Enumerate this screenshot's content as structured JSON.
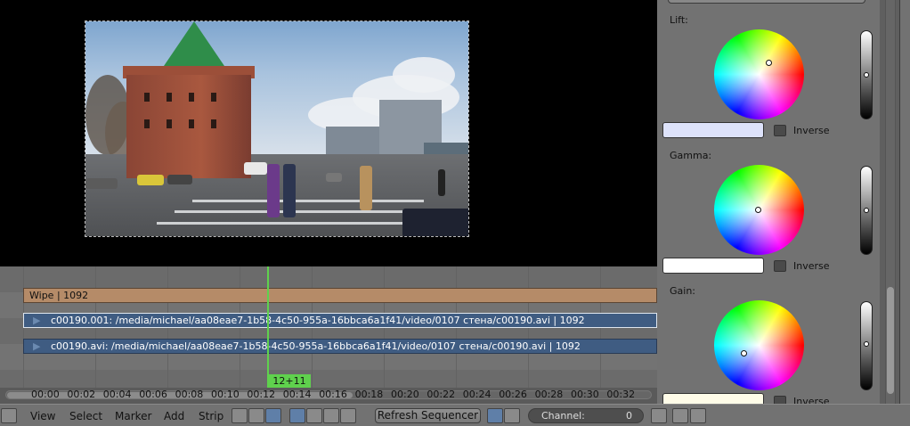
{
  "sequencer": {
    "strips": {
      "wipe": "Wipe | 1092",
      "image1": "c00190.001: /media/michael/aa08eae7-1b58-4c50-955a-16bbca6a1f41/video/0107 стена/c00190.avi | 1092",
      "image2": "c00190.avi: /media/michael/aa08eae7-1b58-4c50-955a-16bbca6a1f41/video/0107 стена/c00190.avi | 1092"
    },
    "current_frame": "12+11",
    "ticks": [
      "00:00",
      "00:02",
      "00:04",
      "00:06",
      "00:08",
      "00:10",
      "00:12",
      "00:14",
      "00:16",
      "00:18",
      "00:20",
      "00:22",
      "00:24",
      "00:26",
      "00:28",
      "00:30",
      "00:32"
    ]
  },
  "header": {
    "menus": [
      "View",
      "Select",
      "Marker",
      "Add",
      "Strip"
    ],
    "refresh_label": "Refresh Sequencer",
    "channel_label": "Channel:",
    "channel_value": "0"
  },
  "panel": {
    "lift_label": "Lift:",
    "gamma_label": "Gamma:",
    "gain_label": "Gain:",
    "inverse_label": "Inverse",
    "lift_swatch_color": "#dde2fa",
    "gamma_swatch_color": "#ffffff",
    "gain_swatch_color": "#fffce8"
  },
  "colors": {
    "playhead": "#5fd14d",
    "wipe_strip": "#b58b68",
    "image_strip": "#3f5c82",
    "panel_bg": "#727272"
  }
}
